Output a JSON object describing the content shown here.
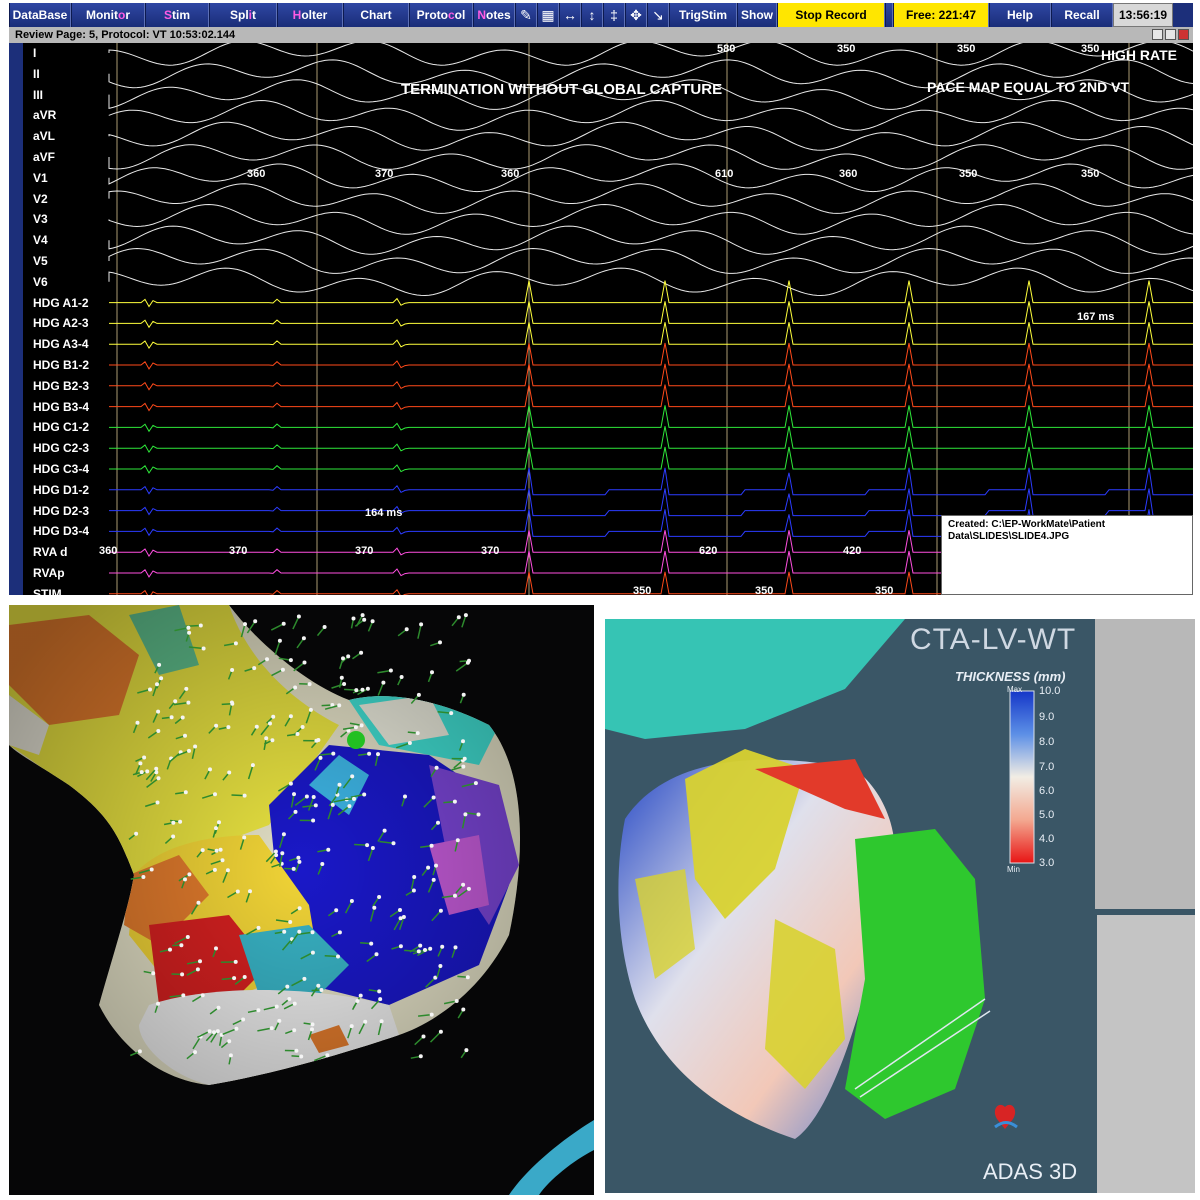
{
  "toolbar": {
    "buttons": [
      {
        "pre": "Data",
        "hl": "",
        "post": "Base"
      },
      {
        "pre": "Monit",
        "hl": "o",
        "post": "r"
      },
      {
        "pre": "",
        "hl": "S",
        "post": "tim"
      },
      {
        "pre": "Spl",
        "hl": "i",
        "post": "t"
      },
      {
        "pre": "",
        "hl": "H",
        "post": "olter"
      },
      {
        "pre": "Chart",
        "hl": "",
        "post": ""
      },
      {
        "pre": "Proto",
        "hl": "c",
        "post": "ol"
      },
      {
        "pre": "",
        "hl": "N",
        "post": "otes"
      }
    ],
    "trigstim_label": "TrigStim",
    "show_label": "Show",
    "stop_record_label": "Stop Record",
    "free_label": "Free:  221:47",
    "help_label": "Help",
    "recall_label": "Recall",
    "clock": "13:56:19",
    "icons": [
      "pen-icon",
      "grid-icon",
      "caliper-icon",
      "vertical-caliper-icon",
      "marker-icon",
      "move-icon",
      "diagonal-arrow-icon"
    ],
    "accent": "#ff5be4"
  },
  "review": {
    "title": "Review Page: 5, Protocol: VT     10:53:02.144"
  },
  "channels": [
    {
      "label": "I",
      "color": "#e8e8e8"
    },
    {
      "label": "II",
      "color": "#e8e8e8"
    },
    {
      "label": "III",
      "color": "#e8e8e8"
    },
    {
      "label": "aVR",
      "color": "#e8e8e8"
    },
    {
      "label": "aVL",
      "color": "#e8e8e8"
    },
    {
      "label": "aVF",
      "color": "#e8e8e8"
    },
    {
      "label": "V1",
      "color": "#e8e8e8"
    },
    {
      "label": "V2",
      "color": "#e8e8e8"
    },
    {
      "label": "V3",
      "color": "#e8e8e8"
    },
    {
      "label": "V4",
      "color": "#e8e8e8"
    },
    {
      "label": "V5",
      "color": "#e8e8e8"
    },
    {
      "label": "V6",
      "color": "#e8e8e8"
    },
    {
      "label": "HDG A1-2",
      "color": "#ffff3c"
    },
    {
      "label": "HDG A2-3",
      "color": "#ffff3c"
    },
    {
      "label": "HDG A3-4",
      "color": "#ffff3c"
    },
    {
      "label": "HDG B1-2",
      "color": "#ff4a1a"
    },
    {
      "label": "HDG B2-3",
      "color": "#ff4a1a"
    },
    {
      "label": "HDG B3-4",
      "color": "#ff4a1a"
    },
    {
      "label": "HDG C1-2",
      "color": "#2ee83a"
    },
    {
      "label": "HDG C2-3",
      "color": "#2ee83a"
    },
    {
      "label": "HDG C3-4",
      "color": "#2ee83a"
    },
    {
      "label": "HDG D1-2",
      "color": "#2c3cff"
    },
    {
      "label": "HDG D2-3",
      "color": "#2c3cff"
    },
    {
      "label": "HDG D3-4",
      "color": "#2c3cff"
    },
    {
      "label": "RVA d",
      "color": "#ff4fe0"
    },
    {
      "label": "RVAp",
      "color": "#ff4fe0"
    },
    {
      "label": "STIM",
      "color": "#ff4a1a"
    }
  ],
  "annotations": {
    "termination": "TERMINATION WITHOUT GLOBAL CAPTURE",
    "pace_map": "PACE MAP EQUAL TO 2ND VT",
    "high_rate": "HIGH RATE"
  },
  "intervals_top": [
    "580",
    "350",
    "350",
    "350"
  ],
  "intervals_v1": [
    "360",
    "370",
    "360",
    "610",
    "360",
    "350",
    "350"
  ],
  "intervals_rva": [
    "360",
    "370",
    "370",
    "370",
    "620",
    "420"
  ],
  "intervals_stim": [
    "350",
    "350",
    "350"
  ],
  "caliper_hdg": "167 ms",
  "caliper_d": "164 ms",
  "created_box": {
    "line1": "Created:  C:\\EP-WorkMate\\Patient",
    "line2": "Data\\SLIDES\\SLIDE4.JPG"
  },
  "ct": {
    "title": "CTA-LV-WT",
    "subtitle": "THICKNESS (mm)",
    "scale_max_tag": "Max",
    "scale_min_tag": "Min",
    "scale_values": [
      "10.0",
      "9.0",
      "8.0",
      "7.0",
      "6.0",
      "5.0",
      "4.0",
      "3.0"
    ],
    "logo": "ADAS 3D",
    "colors": {
      "max": "#1537c8",
      "mid": "#f2ede4",
      "min": "#e81414"
    }
  }
}
